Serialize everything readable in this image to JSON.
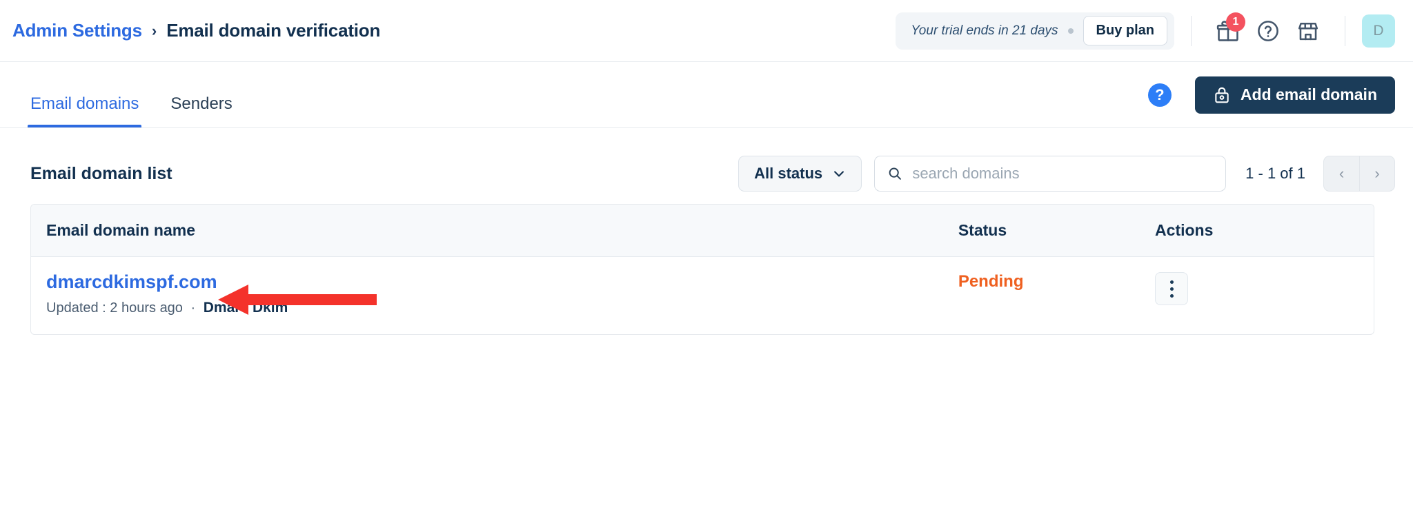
{
  "breadcrumb": {
    "parent": "Admin Settings",
    "separator": "›",
    "current": "Email domain verification"
  },
  "topbar": {
    "trial_text": "Your trial ends in 21 days",
    "buy_label": "Buy plan",
    "gift_badge": "1",
    "gift_icon": "gift-icon",
    "help_icon": "help-circle-icon",
    "store_icon": "store-icon",
    "avatar_initial": "D"
  },
  "tabs": [
    {
      "label": "Email domains",
      "active": true
    },
    {
      "label": "Senders",
      "active": false
    }
  ],
  "tab_actions": {
    "help_glyph": "?",
    "add_domain_label": "Add email domain",
    "add_domain_icon": "lock-icon"
  },
  "list": {
    "title": "Email domain list",
    "status_filter": "All status",
    "status_filter_icon": "chevron-down-icon",
    "search_placeholder": "search domains",
    "search_value": "",
    "search_icon": "search-icon",
    "page_count": "1 - 1 of 1",
    "prev_glyph": "‹",
    "next_glyph": "›"
  },
  "table": {
    "columns": [
      "Email domain name",
      "Status",
      "Actions"
    ],
    "rows": [
      {
        "domain": "dmarcdkimspf.com",
        "updated_label": "Updated :",
        "updated_value": "2 hours ago",
        "meta_separator": "·",
        "owner": "Dmarc Dkim",
        "status": "Pending",
        "action_icon": "kebab-menu-icon"
      }
    ]
  },
  "annotation": {
    "type": "arrow",
    "color": "#f4322b",
    "points_to": "dmarcdkimspf.com"
  },
  "colors": {
    "link_blue": "#2d6ae0",
    "primary_dark": "#1b3c59",
    "status_pending": "#ef6020",
    "badge_red": "#f4525f",
    "avatar_bg": "#b3ecf2",
    "annotation_red": "#f4322b"
  }
}
